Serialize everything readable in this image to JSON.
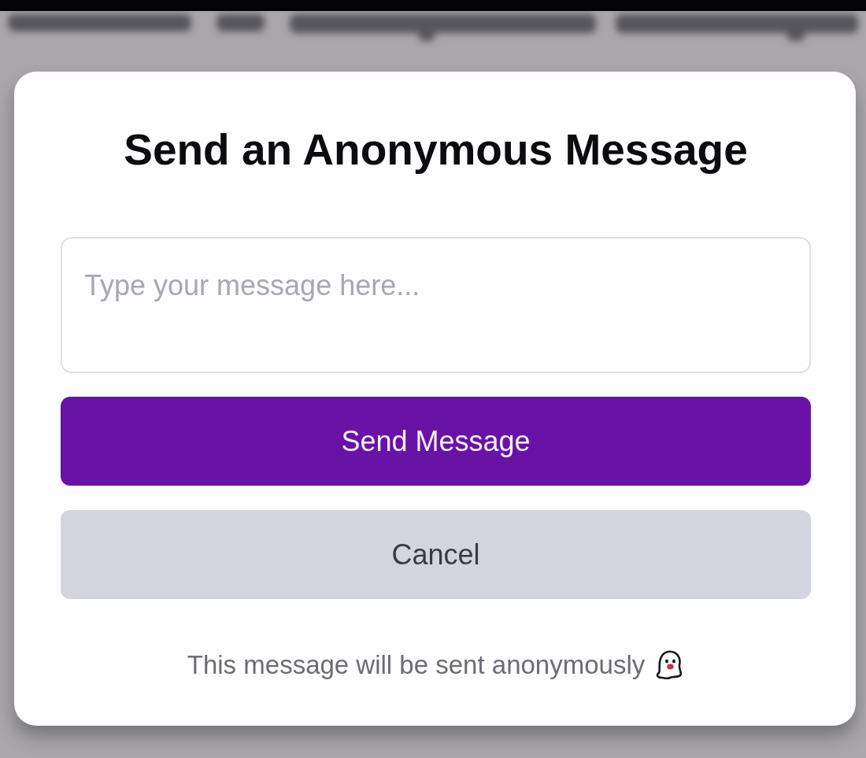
{
  "dialog": {
    "title": "Send an Anonymous Message",
    "message_field": {
      "placeholder": "Type your message here..."
    },
    "buttons": [
      {
        "label": "Send Message",
        "kind": "primary"
      },
      {
        "label": "Cancel",
        "kind": "secondary"
      }
    ],
    "footer_note": "This message will be sent anonymously"
  }
}
